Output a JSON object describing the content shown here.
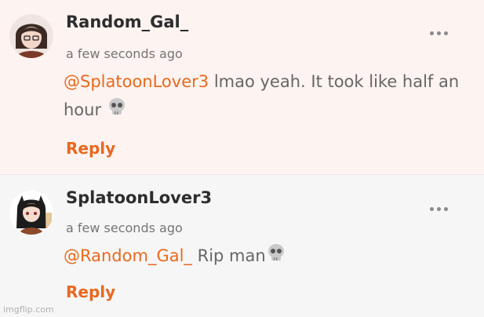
{
  "comments": [
    {
      "username": "Random_Gal_",
      "timestamp": "a few seconds ago",
      "mention": "@SplatoonLover3",
      "text": "lmao yeah. It took like half an hour",
      "reply_label": "Reply"
    },
    {
      "username": "SplatoonLover3",
      "timestamp": "a few seconds ago",
      "mention": "@Random_Gal_",
      "text": "Rip man",
      "reply_label": "Reply"
    }
  ],
  "icons": {
    "more": "more-options-icon",
    "emoji": "skull-emoji-icon"
  },
  "colors": {
    "accent": "#e8691f",
    "highlight_bg": "#fdf3f0"
  },
  "watermark": "imgflip.com"
}
